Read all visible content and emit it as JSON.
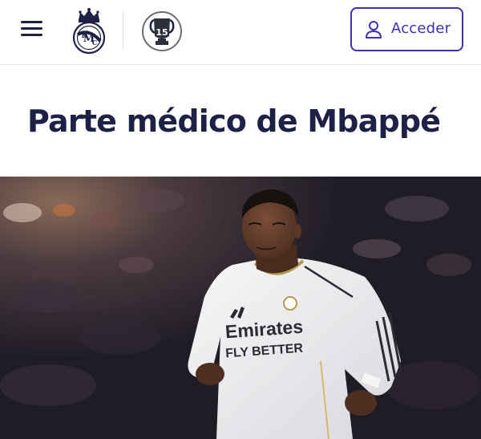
{
  "header": {
    "menu_icon": "hamburger-menu-icon",
    "crest_icon": "real-madrid-crest-icon",
    "trophy_badge": {
      "icon": "champions-trophy-icon",
      "text": "15"
    },
    "login_button": {
      "label": "Acceder",
      "icon": "user-icon"
    }
  },
  "article": {
    "title": "Parte médico de Mbappé"
  },
  "hero_image": {
    "jersey_sponsor_line1": "Emirates",
    "jersey_sponsor_line2": "FLY BETTER"
  },
  "colors": {
    "navy": "#1e2146",
    "accent": "#3e31b0",
    "gold": "#b59a4e"
  }
}
